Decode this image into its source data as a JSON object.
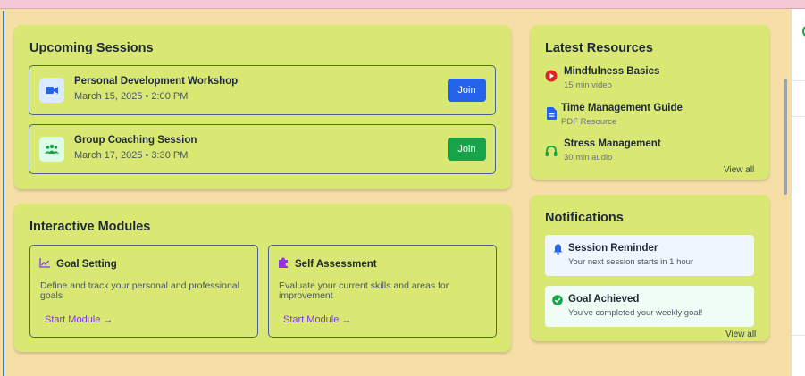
{
  "upcoming": {
    "title": "Upcoming Sessions",
    "sessions": [
      {
        "name": "Personal Development Workshop",
        "date": "March 15, 2025 • 2:00 PM",
        "join": "Join",
        "icon": "video-icon",
        "button_color": "#2563eb",
        "icon_bg": "#dbeafe"
      },
      {
        "name": "Group Coaching Session",
        "date": "March 17, 2025 • 3:30 PM",
        "join": "Join",
        "icon": "users-icon",
        "button_color": "#16a34a",
        "icon_bg": "#dcfce7"
      }
    ]
  },
  "modules": {
    "title": "Interactive Modules",
    "items": [
      {
        "title": "Goal Setting",
        "desc": "Define and track your personal and professional goals",
        "link": "Start Module →",
        "icon": "chart-line-icon"
      },
      {
        "title": "Self Assessment",
        "desc": "Evaluate your current skills and areas for improvement",
        "link": "Start Module →",
        "icon": "puzzle-icon"
      }
    ]
  },
  "resources": {
    "title": "Latest Resources",
    "items": [
      {
        "title": "Mindfulness Basics",
        "sub": "15 min video",
        "icon": "play-circle-icon"
      },
      {
        "title": "Time Management Guide",
        "sub": "PDF Resource",
        "icon": "document-icon"
      },
      {
        "title": "Stress Management",
        "sub": "30 min audio",
        "icon": "headphones-icon"
      }
    ],
    "view_all": "View all"
  },
  "notifications": {
    "title": "Notifications",
    "items": [
      {
        "title": "Session Reminder",
        "sub": "Your next session starts in 1 hour",
        "icon": "bell-icon",
        "bg": "#eff6ff"
      },
      {
        "title": "Goal Achieved",
        "sub": "You've completed your weekly goal!",
        "icon": "check-circle-icon",
        "bg": "#f0fdf4"
      }
    ],
    "view_all": "View all"
  },
  "colors": {
    "card": "#d9e872",
    "page": "#f6dfa6",
    "accent_purple": "#7c3aed"
  }
}
